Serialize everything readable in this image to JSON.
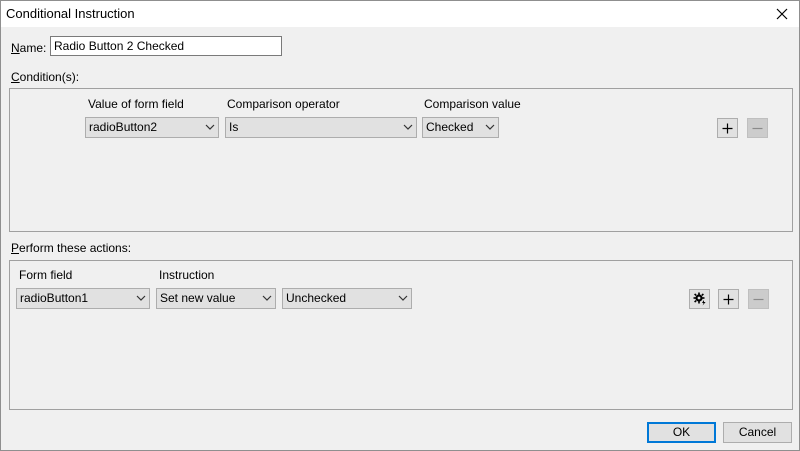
{
  "window": {
    "title": "Conditional Instruction"
  },
  "name_field": {
    "label": "Name:",
    "value": "Radio Button 2 Checked"
  },
  "conditions": {
    "label": "Condition(s):",
    "columns": {
      "form_field": "Value of form field",
      "operator": "Comparison operator",
      "value": "Comparison value"
    },
    "row": {
      "form_field": "radioButton2",
      "operator": "Is",
      "value": "Checked"
    }
  },
  "actions": {
    "label": "Perform these actions:",
    "columns": {
      "form_field": "Form field",
      "instruction": "Instruction"
    },
    "row": {
      "form_field": "radioButton1",
      "instruction": "Set new value",
      "value": "Unchecked"
    }
  },
  "buttons": {
    "ok": "OK",
    "cancel": "Cancel"
  },
  "icons": {
    "close": "close-icon",
    "add": "plus-icon",
    "remove": "minus-icon",
    "settings": "gear-icon",
    "dropdown": "chevron-down-icon"
  }
}
